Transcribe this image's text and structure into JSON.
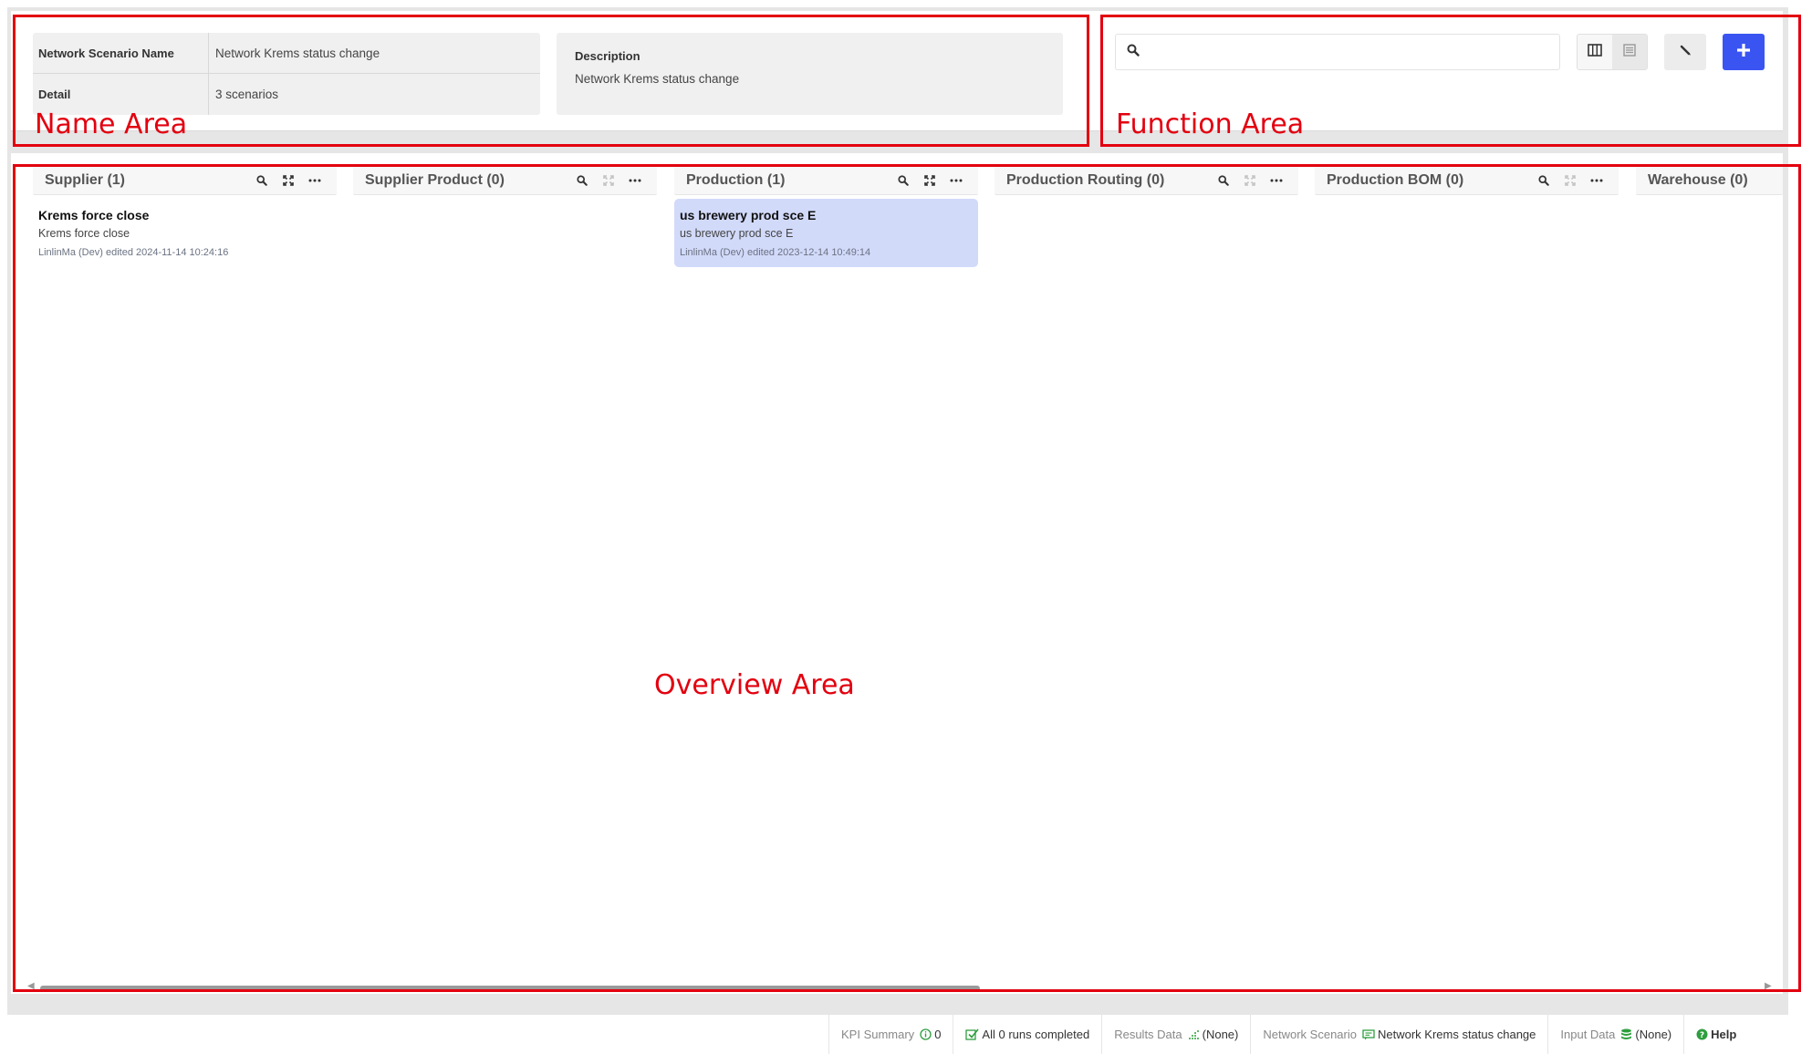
{
  "name_area": {
    "rows": [
      {
        "key": "Network Scenario Name",
        "value": "Network Krems status change"
      },
      {
        "key": "Detail",
        "value": "3 scenarios"
      }
    ],
    "description_label": "Description",
    "description_text": "Network Krems status change"
  },
  "function_area": {
    "search_placeholder": "",
    "icons": {
      "search": "search-icon",
      "column_view": "column-view-icon",
      "list_view": "list-view-icon",
      "edit": "pencil-icon",
      "add": "plus-icon"
    },
    "accent_color": "#3a54f2"
  },
  "columns": [
    {
      "title": "Supplier (1)",
      "cards": [
        {
          "title": "Krems force close",
          "subtitle": "Krems force close",
          "meta": "LinlinMa (Dev) edited 2024-11-14 10:24:16",
          "selected": false
        }
      ]
    },
    {
      "title": "Supplier Product (0)",
      "cards": []
    },
    {
      "title": "Production (1)",
      "cards": [
        {
          "title": "us brewery prod sce E",
          "subtitle": "us brewery prod sce E",
          "meta": "LinlinMa (Dev) edited 2023-12-14 10:49:14",
          "selected": true
        }
      ]
    },
    {
      "title": "Production Routing (0)",
      "cards": []
    },
    {
      "title": "Production BOM (0)",
      "cards": []
    },
    {
      "title": "Warehouse (0)",
      "cards": []
    }
  ],
  "status_bar": {
    "kpi_label": "KPI Summary",
    "kpi_value": "0",
    "runs": "All 0 runs completed",
    "results_label": "Results Data",
    "results_value": "(None)",
    "network_label": "Network Scenario",
    "network_value": "Network Krems status change",
    "input_label": "Input Data",
    "input_value": "(None)",
    "help": "Help"
  },
  "annotations": {
    "name_area": "Name Area",
    "function_area": "Function Area",
    "overview_area": "Overview Area",
    "color": "#e3000f"
  }
}
